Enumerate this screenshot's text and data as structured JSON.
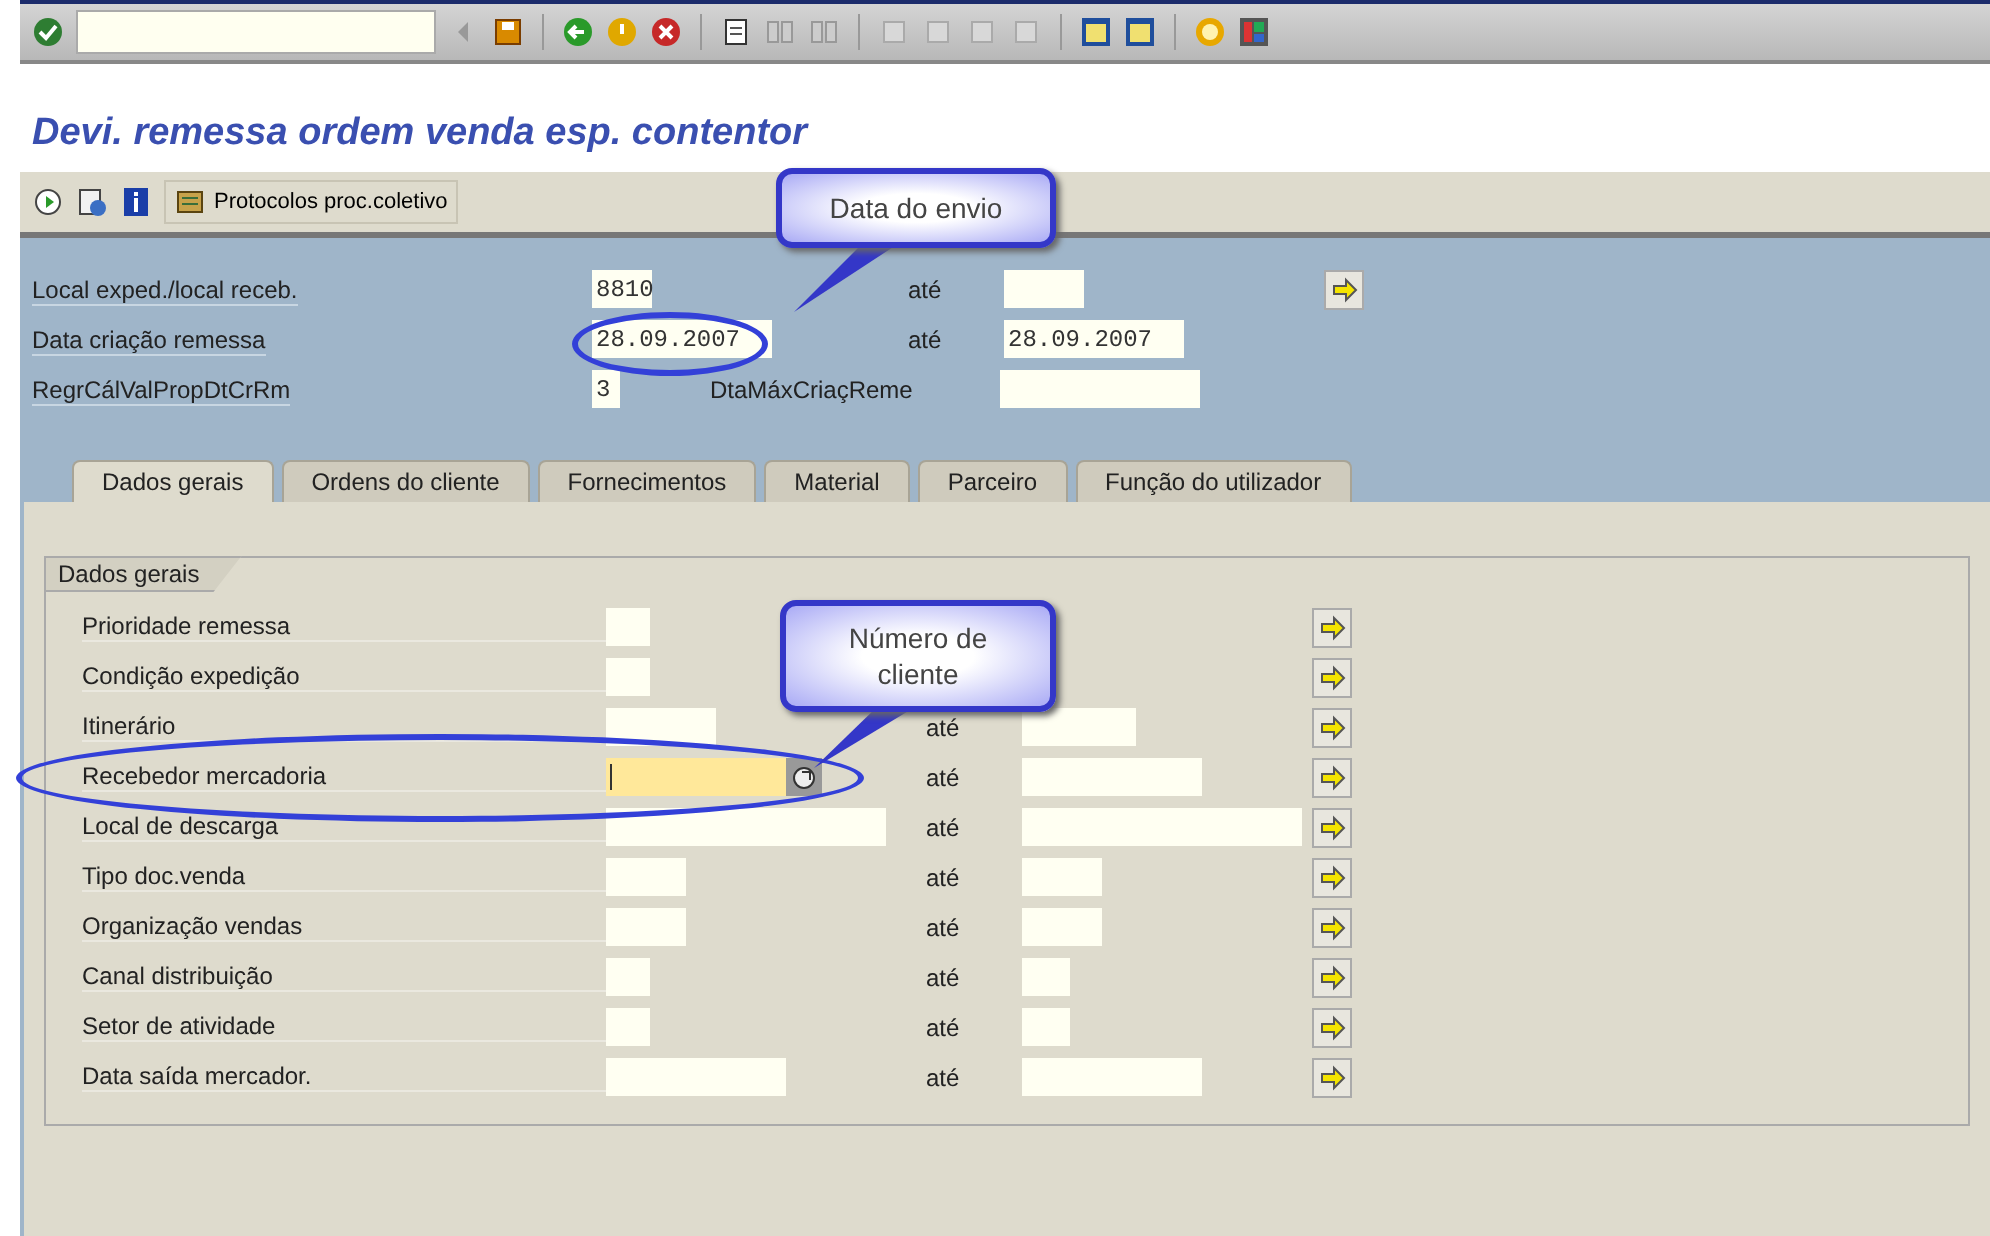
{
  "title": "Devi. remessa ordem venda esp. contentor",
  "app_toolbar": {
    "button": "Protocolos proc.coletivo"
  },
  "header_rows": [
    {
      "label": "Local exped./local receb.",
      "from": "8810",
      "to_label": "até",
      "arrow": true
    },
    {
      "label": "Data criação remessa",
      "from": "28.09.2007",
      "to_label": "até",
      "to": "28.09.2007",
      "arrow": false
    },
    {
      "label": "RegrCálValPropDtCrRm",
      "from": "3",
      "to_label": "DtaMáxCriaçReme",
      "arrow": false
    }
  ],
  "tabs": [
    {
      "label": "Dados gerais",
      "selected": true
    },
    {
      "label": "Ordens do cliente",
      "selected": false
    },
    {
      "label": "Fornecimentos",
      "selected": false
    },
    {
      "label": "Material",
      "selected": false
    },
    {
      "label": "Parceiro",
      "selected": false
    },
    {
      "label": "Função do utilizador",
      "selected": false
    }
  ],
  "group": {
    "title": "Dados gerais",
    "rows": [
      {
        "label": "Prioridade remessa",
        "range": false,
        "focused": false
      },
      {
        "label": "Condição expedição",
        "range": false,
        "focused": false
      },
      {
        "label": "Itinerário",
        "to_label": "até",
        "range": true,
        "focused": false
      },
      {
        "label": "Recebedor mercadoria",
        "to_label": "até",
        "range": true,
        "focused": true
      },
      {
        "label": "Local de descarga",
        "to_label": "até",
        "range": true,
        "focused": false
      },
      {
        "label": "Tipo doc.venda",
        "to_label": "até",
        "range": true,
        "focused": false
      },
      {
        "label": "Organização vendas",
        "to_label": "até",
        "range": true,
        "focused": false
      },
      {
        "label": "Canal distribuição",
        "to_label": "até",
        "range": true,
        "focused": false
      },
      {
        "label": "Setor de atividade",
        "to_label": "até",
        "range": true,
        "focused": false
      },
      {
        "label": "Data saída mercador.",
        "to_label": "até",
        "range": true,
        "focused": false
      }
    ]
  },
  "callouts": [
    {
      "text": "Data do envio"
    },
    {
      "text": "Número de cliente"
    }
  ]
}
